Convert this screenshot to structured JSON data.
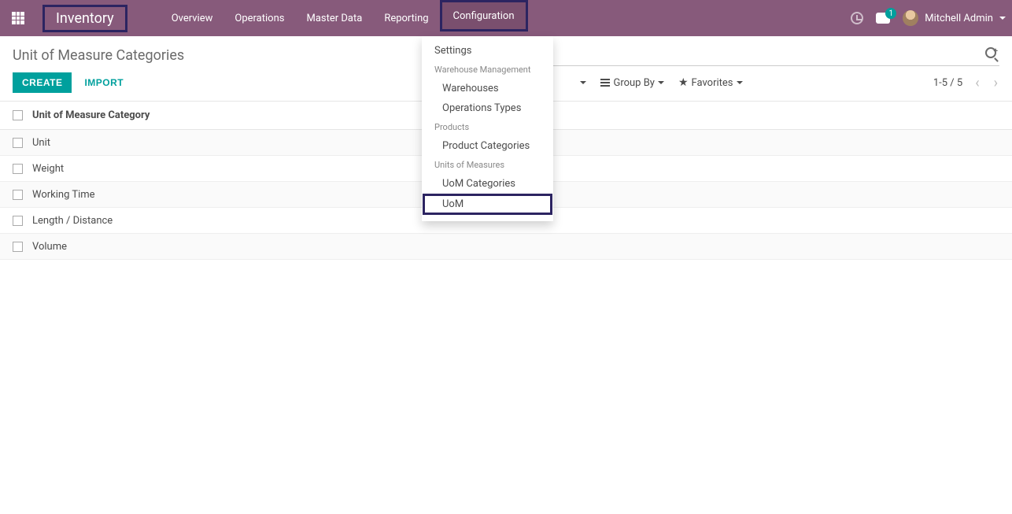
{
  "topbar": {
    "app_title": "Inventory",
    "nav": [
      "Overview",
      "Operations",
      "Master Data",
      "Reporting",
      "Configuration"
    ],
    "active_nav_index": 4,
    "msg_badge": "1",
    "user_name": "Mitchell Admin"
  },
  "dropdown": {
    "items": [
      {
        "type": "item",
        "label": "Settings",
        "sub": false
      },
      {
        "type": "header",
        "label": "Warehouse Management"
      },
      {
        "type": "item",
        "label": "Warehouses",
        "sub": true
      },
      {
        "type": "item",
        "label": "Operations Types",
        "sub": true
      },
      {
        "type": "header",
        "label": "Products"
      },
      {
        "type": "item",
        "label": "Product Categories",
        "sub": true
      },
      {
        "type": "header",
        "label": "Units of Measures"
      },
      {
        "type": "item",
        "label": "UoM Categories",
        "sub": true
      },
      {
        "type": "item",
        "label": "UoM",
        "sub": true,
        "highlight": true
      }
    ]
  },
  "control_panel": {
    "breadcrumb": "Unit of Measure Categories",
    "create_label": "CREATE",
    "import_label": "IMPORT",
    "search_placeholder": "",
    "filters": {
      "group_by": "Group By",
      "favorites": "Favorites"
    },
    "pager": "1-5 / 5"
  },
  "list": {
    "header": "Unit of Measure Category",
    "rows": [
      "Unit",
      "Weight",
      "Working Time",
      "Length / Distance",
      "Volume"
    ]
  }
}
